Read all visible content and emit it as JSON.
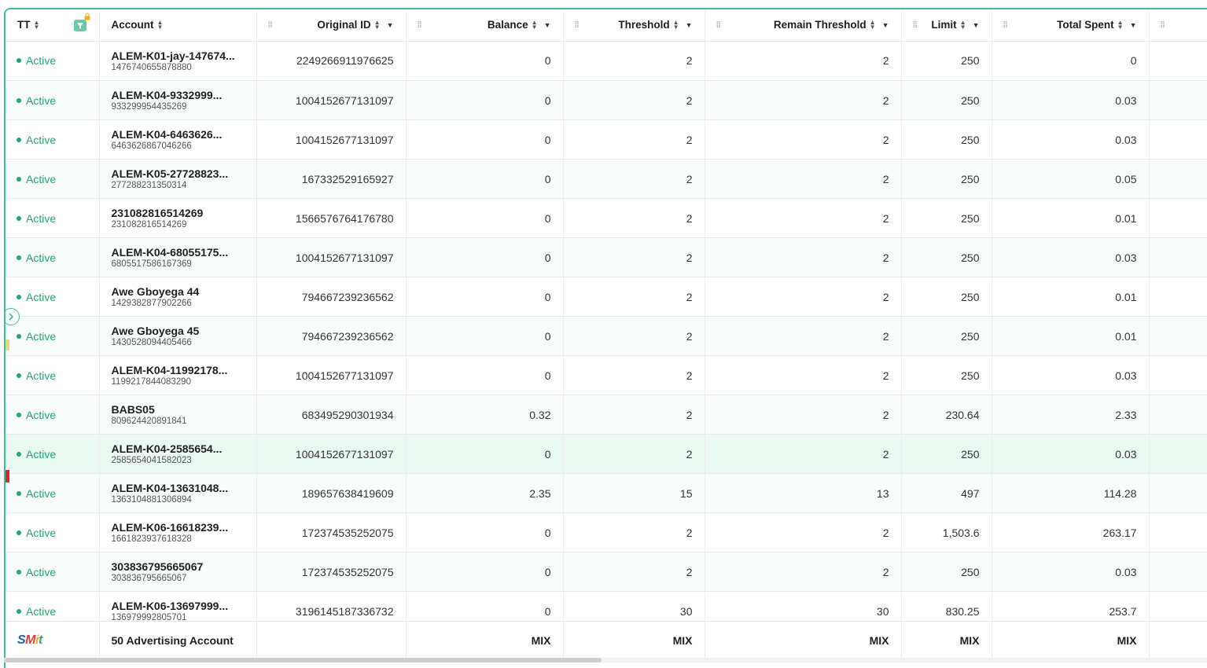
{
  "columns": {
    "tt": "TT",
    "account": "Account",
    "original_id": "Original ID",
    "balance": "Balance",
    "threshold": "Threshold",
    "remain_threshold": "Remain Threshold",
    "limit": "Limit",
    "total_spent": "Total Spent"
  },
  "rows": [
    {
      "status": "Active",
      "name": "ALEM-K01-jay-147674...",
      "sub": "1476740655878880",
      "oid": "2249266911976625",
      "balance": "0",
      "threshold": "2",
      "remain": "2",
      "limit": "250",
      "spent": "0"
    },
    {
      "status": "Active",
      "name": "ALEM-K04-9332999...",
      "sub": "933299954435269",
      "oid": "1004152677131097",
      "balance": "0",
      "threshold": "2",
      "remain": "2",
      "limit": "250",
      "spent": "0.03"
    },
    {
      "status": "Active",
      "name": "ALEM-K04-6463626...",
      "sub": "6463626867046266",
      "oid": "1004152677131097",
      "balance": "0",
      "threshold": "2",
      "remain": "2",
      "limit": "250",
      "spent": "0.03"
    },
    {
      "status": "Active",
      "name": "ALEM-K05-27728823...",
      "sub": "277288231350314",
      "oid": "167332529165927",
      "balance": "0",
      "threshold": "2",
      "remain": "2",
      "limit": "250",
      "spent": "0.05"
    },
    {
      "status": "Active",
      "name": "231082816514269",
      "sub": "231082816514269",
      "oid": "1566576764176780",
      "balance": "0",
      "threshold": "2",
      "remain": "2",
      "limit": "250",
      "spent": "0.01"
    },
    {
      "status": "Active",
      "name": "ALEM-K04-68055175...",
      "sub": "6805517586167369",
      "oid": "1004152677131097",
      "balance": "0",
      "threshold": "2",
      "remain": "2",
      "limit": "250",
      "spent": "0.03"
    },
    {
      "status": "Active",
      "name": "Awe Gboyega 44",
      "sub": "1429382877902266",
      "oid": "794667239236562",
      "balance": "0",
      "threshold": "2",
      "remain": "2",
      "limit": "250",
      "spent": "0.01"
    },
    {
      "status": "Active",
      "name": "Awe Gboyega 45",
      "sub": "1430528094405466",
      "oid": "794667239236562",
      "balance": "0",
      "threshold": "2",
      "remain": "2",
      "limit": "250",
      "spent": "0.01"
    },
    {
      "status": "Active",
      "name": "ALEM-K04-11992178...",
      "sub": "1199217844083290",
      "oid": "1004152677131097",
      "balance": "0",
      "threshold": "2",
      "remain": "2",
      "limit": "250",
      "spent": "0.03"
    },
    {
      "status": "Active",
      "name": "BABS05",
      "sub": "809624420891841",
      "oid": "683495290301934",
      "balance": "0.32",
      "threshold": "2",
      "remain": "2",
      "limit": "230.64",
      "spent": "2.33"
    },
    {
      "status": "Active",
      "name": "ALEM-K04-2585654...",
      "sub": "2585654041582023",
      "oid": "1004152677131097",
      "balance": "0",
      "threshold": "2",
      "remain": "2",
      "limit": "250",
      "spent": "0.03"
    },
    {
      "status": "Active",
      "name": "ALEM-K04-13631048...",
      "sub": "1363104881306894",
      "oid": "189657638419609",
      "balance": "2.35",
      "threshold": "15",
      "remain": "13",
      "limit": "497",
      "spent": "114.28"
    },
    {
      "status": "Active",
      "name": "ALEM-K06-16618239...",
      "sub": "1661823937618328",
      "oid": "172374535252075",
      "balance": "0",
      "threshold": "2",
      "remain": "2",
      "limit": "1,503.6",
      "spent": "263.17"
    },
    {
      "status": "Active",
      "name": "303836795665067",
      "sub": "303836795665067",
      "oid": "172374535252075",
      "balance": "0",
      "threshold": "2",
      "remain": "2",
      "limit": "250",
      "spent": "0.03"
    },
    {
      "status": "Active",
      "name": "ALEM-K06-13697999...",
      "sub": "136979992805701",
      "oid": "3196145187336732",
      "balance": "0",
      "threshold": "30",
      "remain": "30",
      "limit": "830.25",
      "spent": "253.7"
    }
  ],
  "highlighted_row": 10,
  "footer": {
    "logo": "SMit",
    "summary": "50 Advertising Account",
    "balance": "MIX",
    "threshold": "MIX",
    "remain": "MIX",
    "limit": "MIX",
    "spent": "MIX"
  },
  "colors": {
    "accent": "#3dbf95",
    "status_active": "#22a66d",
    "row_highlight": "#e9faf3"
  }
}
